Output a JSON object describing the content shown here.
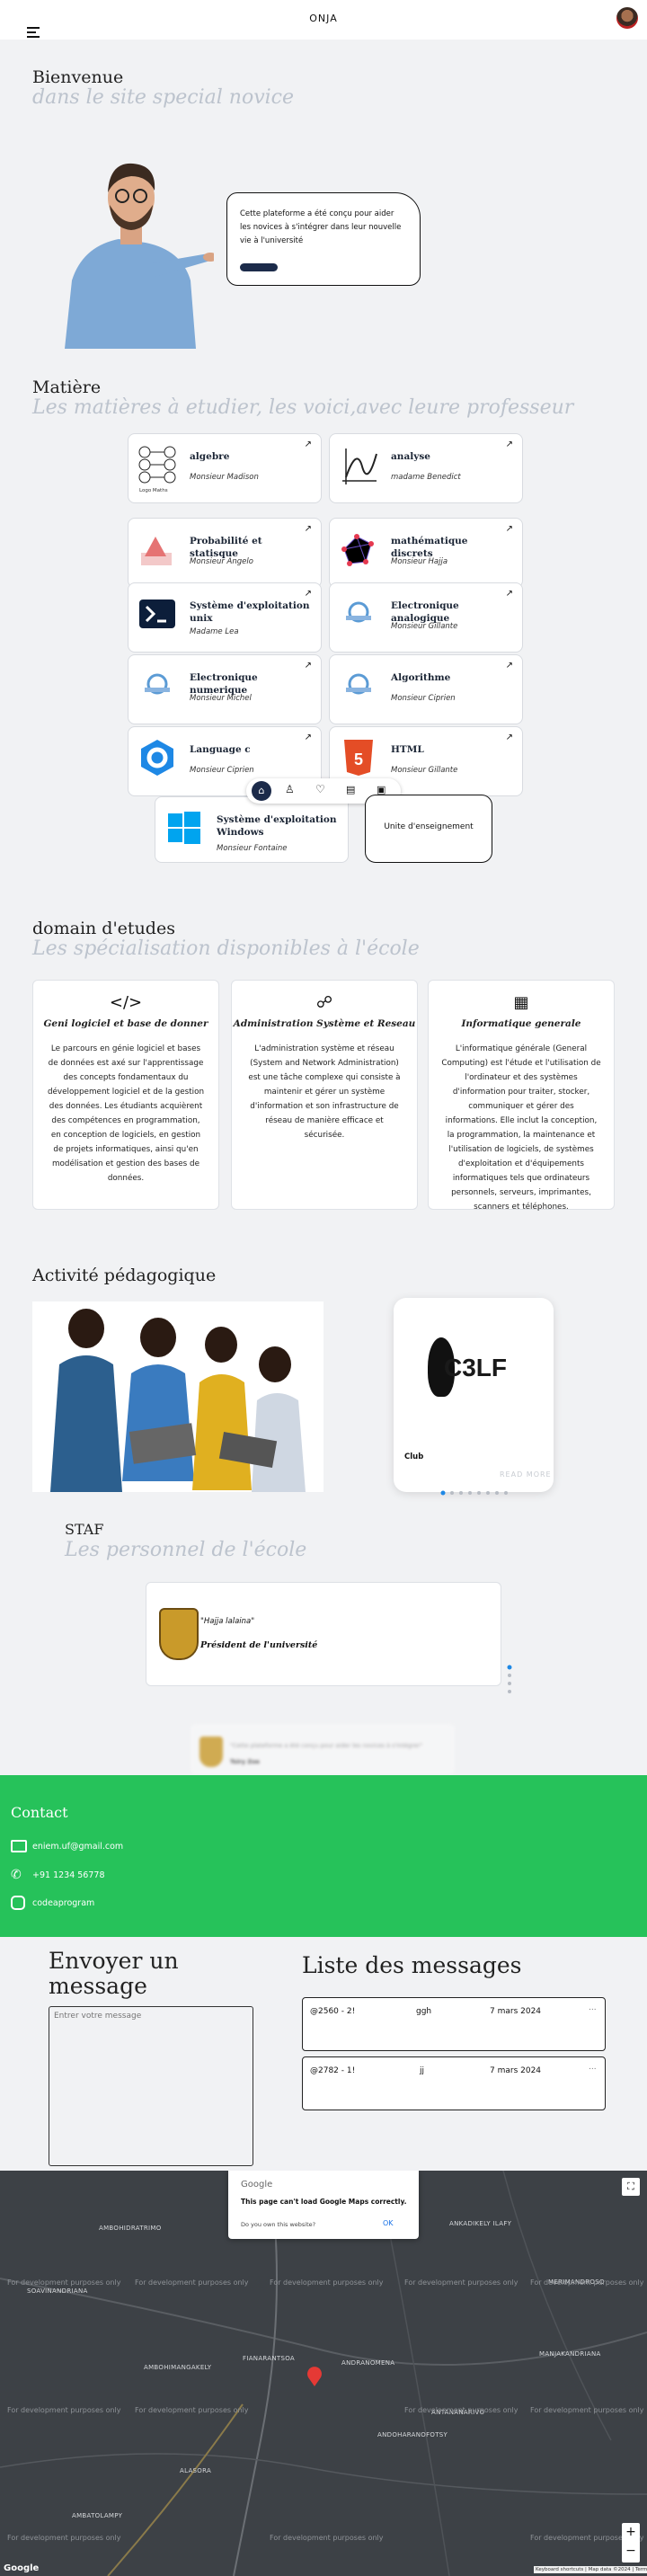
{
  "header": {
    "title": "ONJA"
  },
  "hero": {
    "heading": "Bienvenue",
    "subheading": "dans le site special novice",
    "card_text": "Cette plateforme a été conçu pour aider les novices à s'intégrer dans leur nouvelle vie à l'université"
  },
  "matiere": {
    "heading": "Matière",
    "subheading": "Les matières à etudier, les voici,avec leure professeur",
    "logo_caption": "Logo Maths",
    "subjects": [
      {
        "title": "algebre",
        "prof": "Monsieur Madison",
        "icon": "algebra-logo"
      },
      {
        "title": "analyse",
        "prof": "madame Benedict",
        "icon": "function-graph-icon"
      },
      {
        "title": "Probabilité et statisque",
        "prof": "Monsieur Angelo",
        "icon": "probability-icon"
      },
      {
        "title": "mathématique discrets",
        "prof": "Monsieur Hajja",
        "icon": "graph-network-icon"
      },
      {
        "title": "Système d'exploitation unix",
        "prof": "Madame Lea",
        "icon": "terminal-icon"
      },
      {
        "title": "Electronique analogique",
        "prof": "Monsieur Gillante",
        "icon": "university-logo"
      },
      {
        "title": "Electronique numerique",
        "prof": "Monsieur Michel",
        "icon": "university-logo"
      },
      {
        "title": "Algorithme",
        "prof": "Monsieur Ciprien",
        "icon": "university-logo"
      },
      {
        "title": "Language c",
        "prof": "Monsieur Ciprien",
        "icon": "c-language-icon"
      },
      {
        "title": "HTML",
        "prof": "Monsieur Gillante",
        "icon": "html5-icon"
      },
      {
        "title": "Système d'exploitation Windows",
        "prof": "Monsieur Fontaine",
        "icon": "windows-icon"
      }
    ],
    "unit_button": "Unite d'enseignement",
    "nav_icons": [
      "home-icon",
      "user-icon",
      "heart-icon",
      "card-icon",
      "briefcase-icon"
    ]
  },
  "domain": {
    "heading": "domain d'etudes",
    "subheading": "Les spécialisation disponibles à l'école",
    "items": [
      {
        "icon": "code-icon",
        "title": "Geni logiciel et base de donner",
        "text": "Le parcours en génie logiciel et bases de données est axé sur l'apprentissage des concepts fondamentaux du développement logiciel et de la gestion des données. Les étudiants acquièrent des compétences en programmation, en conception de logiciels, en gestion de projets informatiques, ainsi qu'en modélisation et gestion des bases de données."
      },
      {
        "icon": "network-admin-icon",
        "title": "Administration Système et Reseau",
        "text": "L'administration système et réseau (System and Network Administration) est une tâche complexe qui consiste à maintenir et gérer un système d'information et son infrastructure de réseau de manière efficace et sécurisée."
      },
      {
        "icon": "processor-icon",
        "title": "Informatique generale",
        "text": "L'informatique générale (General Computing) est l'étude et l'utilisation de l'ordinateur et des systèmes d'information pour traiter, stocker, communiquer et gérer des informations. Elle inclut la conception, la programmation, la maintenance et l'utilisation de logiciels, de systèmes d'exploitation et d'équipements informatiques tels que ordinateurs personnels, serveurs, imprimantes, scanners et téléphones."
      }
    ]
  },
  "activite": {
    "heading": "Activité pédagogique",
    "club_logo": "C3LF",
    "club_label": "Club",
    "read_more": "READ MORE"
  },
  "staff": {
    "heading": "STAF",
    "subheading": "Les personnel de l'école",
    "quote": "\"Hajja lalaina\"",
    "role": "Président de l'université",
    "blurred_quote": "\"Cette plateforme a été conçu pour aider les novices à s'intégrer\"",
    "blurred_name": "Tsiry Zoe"
  },
  "contact": {
    "heading": "Contact",
    "email": "eniem.uf@gmail.com",
    "phone": "+91 1234 56778",
    "social": "codeaprogram"
  },
  "messages": {
    "send_heading": "Envoyer un message",
    "placeholder": "Entrer votre message",
    "list_heading": "Liste des messages",
    "items": [
      {
        "user": "@2560 - 2!",
        "text": "ggh",
        "date": "7 mars 2024",
        "more": "..."
      },
      {
        "user": "@2782 - 1!",
        "text": "jj",
        "date": "7 mars 2024",
        "more": "..."
      }
    ]
  },
  "map": {
    "dialog_brand": "Google",
    "dialog_title": "This page can't load Google Maps correctly.",
    "dialog_question": "Do you own this website?",
    "dialog_ok": "OK",
    "watermark": "For development purposes only",
    "places": [
      "AMBOHIDRATRIMO",
      "ANKADIKELY ILAFY",
      "SOAVINANDRIANA",
      "MERIMANDROSO",
      "MANJAKANDRIANA",
      "FIANARANTSOA",
      "ANDRANOMENA",
      "AMBOHIMANGAKELY",
      "ANDOHARANOFOTSY",
      "ANTANANARIVO",
      "ALASORA",
      "AMBATOLAMPY"
    ],
    "google_logo": "Google",
    "attribution": "Keyboard shortcuts | Map data ©2024 | Terms",
    "zoom_in": "+",
    "zoom_out": "−",
    "fullscreen": "⛶"
  },
  "colors": {
    "accent_green": "#26c25a",
    "navy": "#1c2b4a",
    "light_text": "#bcc3cd"
  }
}
